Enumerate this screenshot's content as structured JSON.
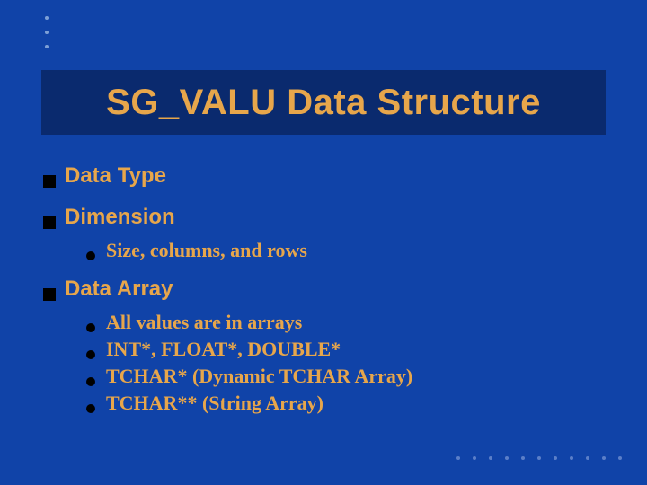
{
  "title": "SG_VALU Data Structure",
  "items": [
    {
      "label": "Data Type",
      "sub": []
    },
    {
      "label": "Dimension",
      "sub": [
        "Size, columns, and rows"
      ]
    },
    {
      "label": "Data Array",
      "sub": [
        "All values are in arrays",
        "INT*, FLOAT*, DOUBLE*",
        "TCHAR* (Dynamic TCHAR Array)",
        "TCHAR** (String Array)"
      ]
    }
  ]
}
